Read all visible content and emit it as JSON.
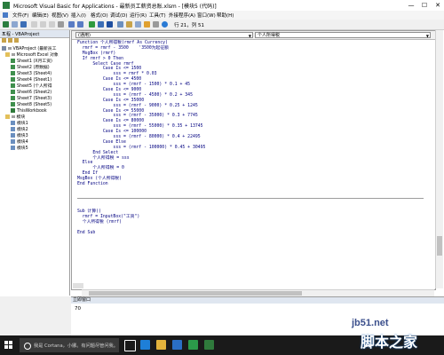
{
  "window": {
    "title": "Microsoft Visual Basic for Applications - 最新员工薪资总账.xlsm - [模块5 (代码)]",
    "minimize": "—",
    "maximize": "☐",
    "close": "✕"
  },
  "menu": [
    "文件(F)",
    "编辑(E)",
    "视图(V)",
    "插入(I)",
    "格式(O)",
    "调试(D)",
    "运行(R)",
    "工具(T)",
    "外接程序(A)",
    "窗口(W)",
    "帮助(H)"
  ],
  "toolbar": {
    "position": "行 21，列 51"
  },
  "project": {
    "title": "工程 - VBAProject",
    "close": "×",
    "rows": [
      {
        "text": "⊟ VBAProject (最新员工",
        "icon": "ic-proj",
        "indent": 0
      },
      {
        "text": "⊟ Microsoft Excel 对象",
        "icon": "ic-folder",
        "indent": 4
      },
      {
        "text": "Sheet1 (X月工资)",
        "icon": "ic-sheet",
        "indent": 10
      },
      {
        "text": "Sheet2 (原数据)",
        "icon": "ic-sheet",
        "indent": 10
      },
      {
        "text": "Sheet3 (Sheet4)",
        "icon": "ic-sheet",
        "indent": 10
      },
      {
        "text": "Sheet4 (Sheet1)",
        "icon": "ic-sheet",
        "indent": 10
      },
      {
        "text": "Sheet5 (个人所得",
        "icon": "ic-sheet",
        "indent": 10
      },
      {
        "text": "Sheet6 (Sheet2)",
        "icon": "ic-sheet",
        "indent": 10
      },
      {
        "text": "Sheet7 (Sheet3)",
        "icon": "ic-sheet",
        "indent": 10
      },
      {
        "text": "Sheet8 (Sheet5)",
        "icon": "ic-sheet",
        "indent": 10
      },
      {
        "text": "ThisWorkbook",
        "icon": "ic-book",
        "indent": 10
      },
      {
        "text": "⊟ 模块",
        "icon": "ic-folder",
        "indent": 4
      },
      {
        "text": "模块1",
        "icon": "ic-mod",
        "indent": 10
      },
      {
        "text": "模块2",
        "icon": "ic-mod",
        "indent": 10
      },
      {
        "text": "模块3",
        "icon": "ic-mod",
        "indent": 10
      },
      {
        "text": "模块4",
        "icon": "ic-mod",
        "indent": 10
      },
      {
        "text": "模块5",
        "icon": "ic-mod",
        "indent": 10
      }
    ]
  },
  "code": {
    "object_combo": "(通用)",
    "proc_combo": "个人所得税",
    "lines1": [
      "Function 个人所得税(rmrf As Currency)",
      "  rmrf = rmrf - 3500    '3500为起征额",
      "  MsgBox (rmrf)",
      "  If rmrf > 0 Then",
      "      Select Case rmrf",
      "          Case Is <= 1500",
      "              sss = rmrf * 0.03",
      "          Case Is <= 4500",
      "              sss = (rmrf - 1500) * 0.1 + 45",
      "          Case Is <= 9000",
      "              sss = (rmrf - 4500) * 0.2 + 345",
      "          Case Is <= 35000",
      "              sss = (rmrf - 9000) * 0.25 + 1245",
      "          Case Is <= 55000",
      "              sss = (rmrf - 35000) * 0.3 + 7745",
      "          Case Is <= 80000",
      "              sss = (rmrf - 55000) * 0.35 + 13745",
      "          Case Is <= 100000",
      "              sss = (rmrf - 80000) * 0.4 + 22495",
      "          Case Else",
      "              sss = (rmrf - 100000) * 0.45 + 30495",
      "      End Select",
      "      个人所得税 = sss",
      "  Else",
      "      个人所得税 = 0",
      "  End If",
      "MsgBox (个人所得税)",
      "End Function"
    ],
    "lines2": [
      "Sub 计算()",
      "  rmrf = InputBox(\"工资\")",
      "  个人所得税 (rmrf)",
      "",
      "End Sub"
    ]
  },
  "immediate": {
    "title": "立即窗口",
    "value": "70"
  },
  "taskbar": {
    "search_text": "我是 Cortana，小娜。有问题尽管问我。"
  },
  "watermark": {
    "site": "jb51.net",
    "brand": "脚本之家"
  }
}
